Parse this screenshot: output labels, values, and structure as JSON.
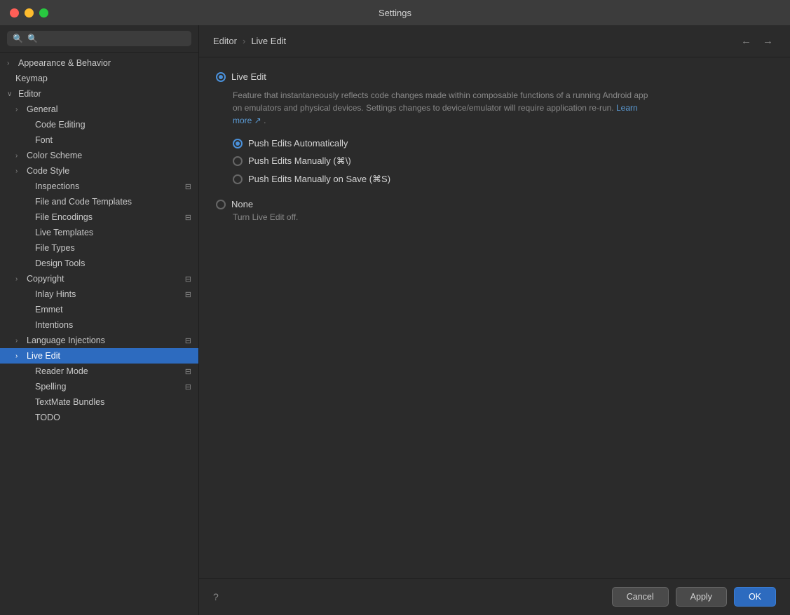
{
  "window": {
    "title": "Settings"
  },
  "sidebar": {
    "search_placeholder": "🔍",
    "items": [
      {
        "id": "appearance",
        "label": "Appearance & Behavior",
        "indent": 0,
        "chevron": "›",
        "expanded": false,
        "badge": ""
      },
      {
        "id": "keymap",
        "label": "Keymap",
        "indent": 0,
        "chevron": "",
        "expanded": false,
        "badge": ""
      },
      {
        "id": "editor",
        "label": "Editor",
        "indent": 0,
        "chevron": "∨",
        "expanded": true,
        "badge": ""
      },
      {
        "id": "general",
        "label": "General",
        "indent": 1,
        "chevron": "›",
        "expanded": false,
        "badge": ""
      },
      {
        "id": "code-editing",
        "label": "Code Editing",
        "indent": 2,
        "chevron": "",
        "expanded": false,
        "badge": ""
      },
      {
        "id": "font",
        "label": "Font",
        "indent": 2,
        "chevron": "",
        "expanded": false,
        "badge": ""
      },
      {
        "id": "color-scheme",
        "label": "Color Scheme",
        "indent": 1,
        "chevron": "›",
        "expanded": false,
        "badge": ""
      },
      {
        "id": "code-style",
        "label": "Code Style",
        "indent": 1,
        "chevron": "›",
        "expanded": false,
        "badge": ""
      },
      {
        "id": "inspections",
        "label": "Inspections",
        "indent": 2,
        "chevron": "",
        "expanded": false,
        "badge": "⊟"
      },
      {
        "id": "file-code-templates",
        "label": "File and Code Templates",
        "indent": 2,
        "chevron": "",
        "expanded": false,
        "badge": ""
      },
      {
        "id": "file-encodings",
        "label": "File Encodings",
        "indent": 2,
        "chevron": "",
        "expanded": false,
        "badge": "⊟"
      },
      {
        "id": "live-templates",
        "label": "Live Templates",
        "indent": 2,
        "chevron": "",
        "expanded": false,
        "badge": ""
      },
      {
        "id": "file-types",
        "label": "File Types",
        "indent": 2,
        "chevron": "",
        "expanded": false,
        "badge": ""
      },
      {
        "id": "design-tools",
        "label": "Design Tools",
        "indent": 2,
        "chevron": "",
        "expanded": false,
        "badge": ""
      },
      {
        "id": "copyright",
        "label": "Copyright",
        "indent": 1,
        "chevron": "›",
        "expanded": false,
        "badge": "⊟"
      },
      {
        "id": "inlay-hints",
        "label": "Inlay Hints",
        "indent": 2,
        "chevron": "",
        "expanded": false,
        "badge": "⊟"
      },
      {
        "id": "emmet",
        "label": "Emmet",
        "indent": 2,
        "chevron": "",
        "expanded": false,
        "badge": ""
      },
      {
        "id": "intentions",
        "label": "Intentions",
        "indent": 2,
        "chevron": "",
        "expanded": false,
        "badge": ""
      },
      {
        "id": "language-injections",
        "label": "Language Injections",
        "indent": 1,
        "chevron": "›",
        "expanded": false,
        "badge": "⊟"
      },
      {
        "id": "live-edit",
        "label": "Live Edit",
        "indent": 1,
        "chevron": "›",
        "expanded": false,
        "badge": "",
        "active": true
      },
      {
        "id": "reader-mode",
        "label": "Reader Mode",
        "indent": 2,
        "chevron": "",
        "expanded": false,
        "badge": "⊟"
      },
      {
        "id": "spelling",
        "label": "Spelling",
        "indent": 2,
        "chevron": "",
        "expanded": false,
        "badge": "⊟"
      },
      {
        "id": "textmate-bundles",
        "label": "TextMate Bundles",
        "indent": 2,
        "chevron": "",
        "expanded": false,
        "badge": ""
      },
      {
        "id": "todo",
        "label": "TODO",
        "indent": 2,
        "chevron": "",
        "expanded": false,
        "badge": ""
      }
    ]
  },
  "header": {
    "breadcrumb_parent": "Editor",
    "breadcrumb_sep": "›",
    "breadcrumb_current": "Live Edit"
  },
  "content": {
    "main_option_label": "Live Edit",
    "description": "Feature that instantaneously reflects code changes made within composable functions of a running Android app on emulators and physical devices. Settings changes to device/emulator will require application re-run.",
    "learn_more_text": "Learn more ↗",
    "learn_more_url": "#",
    "radio_options": [
      {
        "id": "push-auto",
        "label": "Push Edits Automatically",
        "checked": true
      },
      {
        "id": "push-manual",
        "label": "Push Edits Manually (⌘\\)",
        "checked": false
      },
      {
        "id": "push-save",
        "label": "Push Edits Manually on Save (⌘S)",
        "checked": false
      }
    ],
    "none_label": "None",
    "none_desc": "Turn Live Edit off."
  },
  "footer": {
    "cancel_label": "Cancel",
    "apply_label": "Apply",
    "ok_label": "OK"
  }
}
